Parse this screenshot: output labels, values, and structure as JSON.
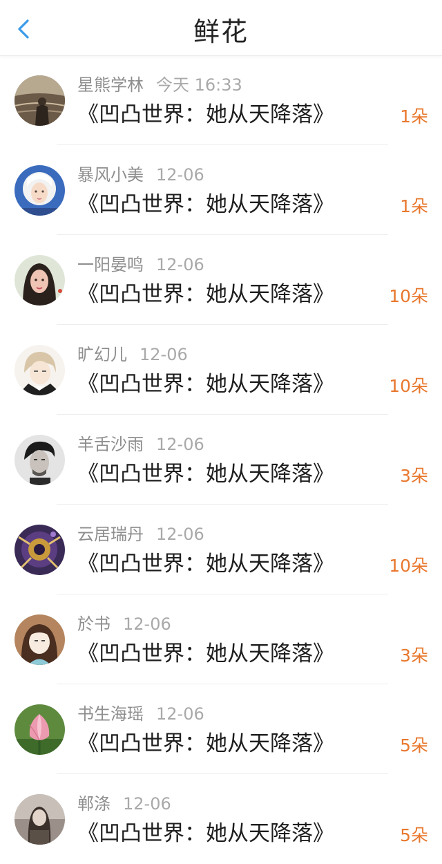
{
  "header": {
    "title": "鲜花",
    "back_icon": "chevron-left-icon",
    "accent_color": "#3a9bea"
  },
  "colors": {
    "count": "#e8782e",
    "name": "#8e8e8e",
    "date": "#a9a9a9",
    "title": "#1e1e1e"
  },
  "items": [
    {
      "name": "星熊学林",
      "date": "今天 16:33",
      "book": "《凹凸世界：她从天降落》",
      "count": "1朵"
    },
    {
      "name": "暴风小美",
      "date": "12-06",
      "book": "《凹凸世界：她从天降落》",
      "count": "1朵"
    },
    {
      "name": "一阳晏鸣",
      "date": "12-06",
      "book": "《凹凸世界：她从天降落》",
      "count": "10朵"
    },
    {
      "name": "旷幻儿",
      "date": "12-06",
      "book": "《凹凸世界：她从天降落》",
      "count": "10朵"
    },
    {
      "name": "羊舌沙雨",
      "date": "12-06",
      "book": "《凹凸世界：她从天降落》",
      "count": "3朵"
    },
    {
      "name": "云居瑞丹",
      "date": "12-06",
      "book": "《凹凸世界：她从天降落》",
      "count": "10朵"
    },
    {
      "name": "於书",
      "date": "12-06",
      "book": "《凹凸世界：她从天降落》",
      "count": "3朵"
    },
    {
      "name": "书生海瑶",
      "date": "12-06",
      "book": "《凹凸世界：她从天降落》",
      "count": "5朵"
    },
    {
      "name": "郸涤",
      "date": "12-06",
      "book": "《凹凸世界：她从天降落》",
      "count": "5朵"
    }
  ]
}
